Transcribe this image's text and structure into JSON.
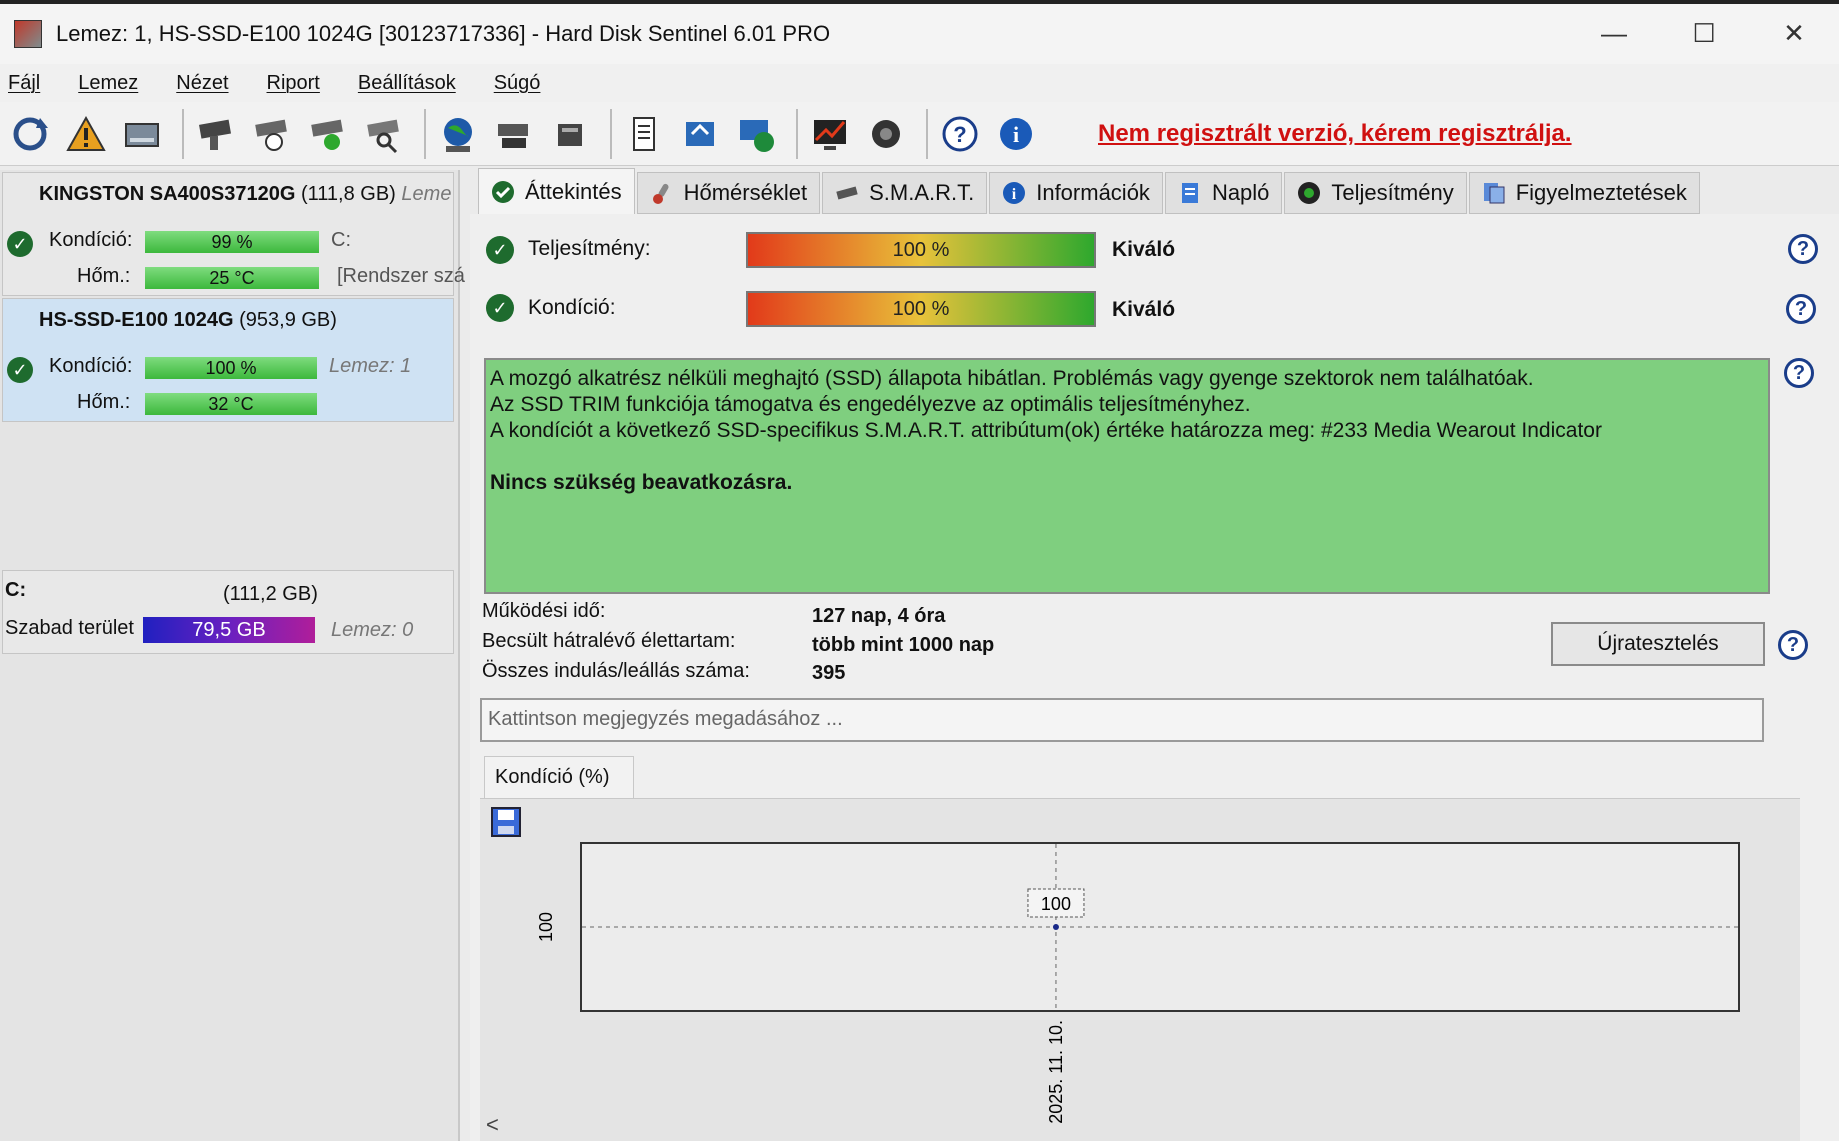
{
  "window": {
    "title": "Lemez: 1, HS-SSD-E100 1024G [30123717336]  -  Hard Disk Sentinel 6.01 PRO",
    "minimize": "—",
    "maximize": "☐",
    "close": "✕"
  },
  "menu": [
    "Fájl",
    "Lemez",
    "Nézet",
    "Riport",
    "Beállítások",
    "Súgó"
  ],
  "registration_text": "Nem regisztrált verzió, kérem regisztrálja.",
  "disks": [
    {
      "name": "KINGSTON SA400S37120G",
      "size": "(111,8 GB)",
      "extra": "Leme",
      "condition_label": "Kondíció:",
      "condition_value": "99 %",
      "condition_pct": 99,
      "temp_label": "Hőm.:",
      "temp_value": "25 °C",
      "note1": "C:",
      "note2": "[Rendszer szá"
    },
    {
      "name": "HS-SSD-E100 1024G",
      "size": "(953,9 GB)",
      "extra": "",
      "condition_label": "Kondíció:",
      "condition_value": "100 %",
      "condition_pct": 100,
      "temp_label": "Hőm.:",
      "temp_value": "32 °C",
      "note1": "Lemez: 1",
      "note2": ""
    }
  ],
  "volume": {
    "letter": "C:",
    "size": "(111,2 GB)",
    "free_label": "Szabad terület",
    "free_value": "79,5 GB",
    "disk_note": "Lemez: 0"
  },
  "tabs": [
    "Áttekintés",
    "Hőmérséklet",
    "S.M.A.R.T.",
    "Információk",
    "Napló",
    "Teljesítmény",
    "Figyelmeztetések"
  ],
  "overview": {
    "performance_label": "Teljesítmény:",
    "performance_value": "100 %",
    "performance_rating": "Kiváló",
    "condition_label": "Kondíció:",
    "condition_value": "100 %",
    "condition_rating": "Kiváló",
    "message_lines": [
      "A mozgó alkatrész nélküli meghajtó (SSD) állapota hibátlan. Problémás vagy gyenge szektorok nem találhatóak.",
      "Az SSD TRIM funkciója támogatva és engedélyezve az optimális teljesítményhez.",
      "A kondíciót a következő SSD-specifikus S.M.A.R.T. attribútum(ok) értéke határozza meg:  #233 Media Wearout Indicator"
    ],
    "message_bold": "Nincs szükség beavatkozásra.",
    "uptime_label": "Működési idő:",
    "uptime_value": "127 nap, 4 óra",
    "remaining_label": "Becsült hátralévő élettartam:",
    "remaining_value": "több mint 1000 nap",
    "startstop_label": "Összes indulás/leállás száma:",
    "startstop_value": "395",
    "retest_button": "Újratesztelés",
    "note_placeholder": "Kattintson megjegyzés megadásához ..."
  },
  "chart_tab_label": "Kondíció  (%)",
  "chart_data": {
    "type": "line",
    "title": "Kondíció  (%)",
    "x": [
      "2025. 11. 10."
    ],
    "series": [
      {
        "values": [
          100
        ]
      }
    ],
    "ytick_labels": [
      "100"
    ],
    "data_labels": [
      "100"
    ],
    "grid": true
  },
  "colors": {
    "good_bar": "#3cb83c",
    "message_bg": "#7fcf7f",
    "register_link": "#d01010",
    "selected_disk_bg": "#cfe2f3"
  }
}
